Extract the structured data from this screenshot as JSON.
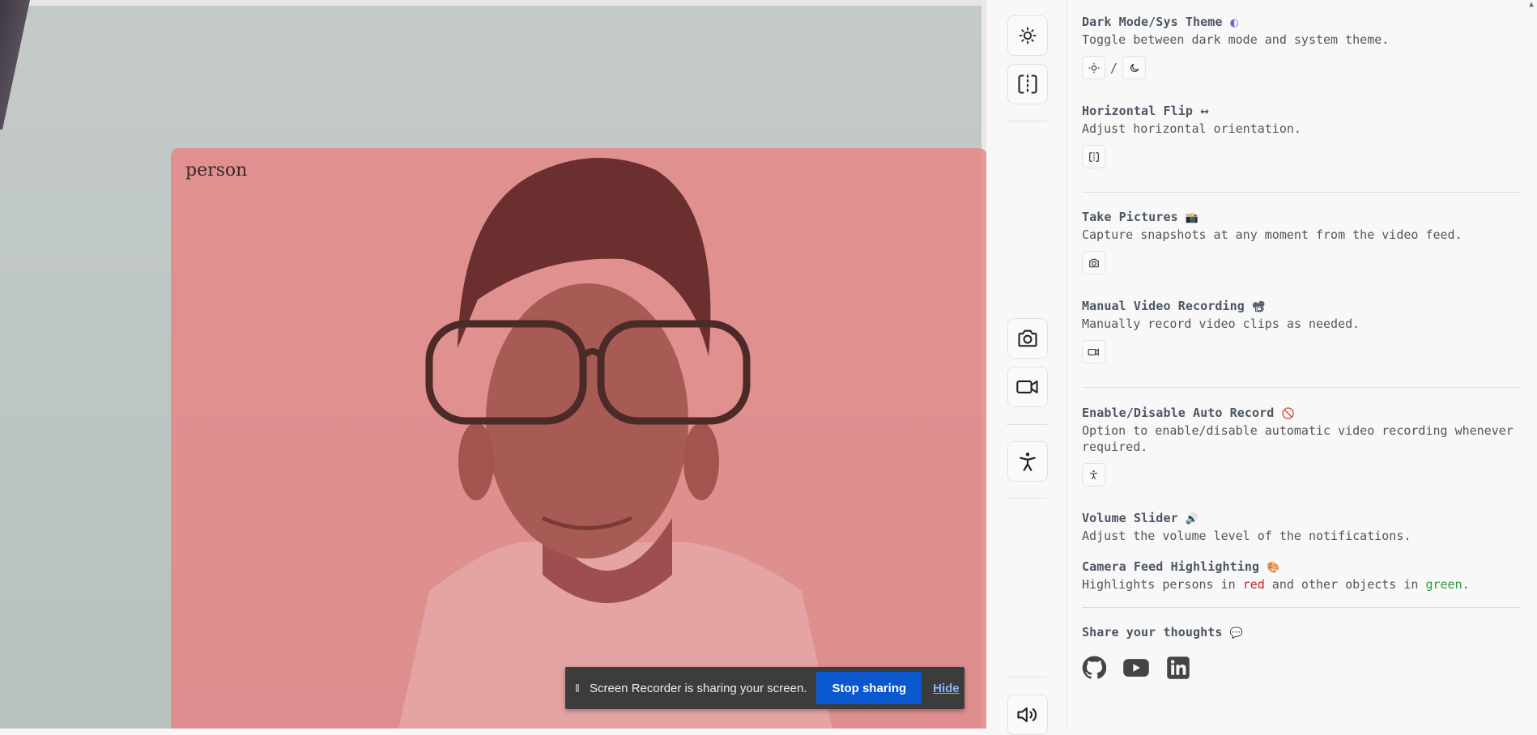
{
  "video": {
    "detection_label": "person",
    "highlight_color": "#e88080"
  },
  "share_banner": {
    "message": "Screen Recorder is sharing your screen.",
    "stop_label": "Stop sharing",
    "hide_label": "Hide"
  },
  "toolbar": {
    "icons": [
      "sun-icon",
      "flip-horizontal-icon",
      "camera-icon",
      "video-icon",
      "accessibility-icon",
      "volume-icon"
    ]
  },
  "panel": {
    "theme": {
      "title": "Dark Mode/Sys Theme",
      "title_emoji": "◐",
      "desc": "Toggle between dark mode and system theme.",
      "separator": "/"
    },
    "flip": {
      "title": "Horizontal Flip",
      "title_emoji": "↔",
      "desc": "Adjust horizontal orientation."
    },
    "pictures": {
      "title": "Take Pictures",
      "title_emoji": "📸",
      "desc": "Capture snapshots at any moment from the video feed."
    },
    "recording": {
      "title": "Manual Video Recording",
      "title_emoji": "📽",
      "desc": "Manually record video clips as needed."
    },
    "auto_record": {
      "title": "Enable/Disable Auto Record",
      "title_emoji": "🚫",
      "desc": "Option to enable/disable automatic video recording whenever required."
    },
    "volume": {
      "title": "Volume Slider",
      "title_emoji": "🔊",
      "desc": "Adjust the volume level of the notifications."
    },
    "highlighting": {
      "title": "Camera Feed Highlighting",
      "title_emoji": "🎨",
      "desc_prefix": "Highlights persons in ",
      "desc_red": "red",
      "desc_middle": " and other objects in ",
      "desc_green": "green",
      "desc_suffix": ".",
      "red_color": "#c81e1e",
      "green_color": "#2b9a3c"
    },
    "thoughts": {
      "title": "Share your thoughts",
      "title_emoji": "💬"
    }
  }
}
